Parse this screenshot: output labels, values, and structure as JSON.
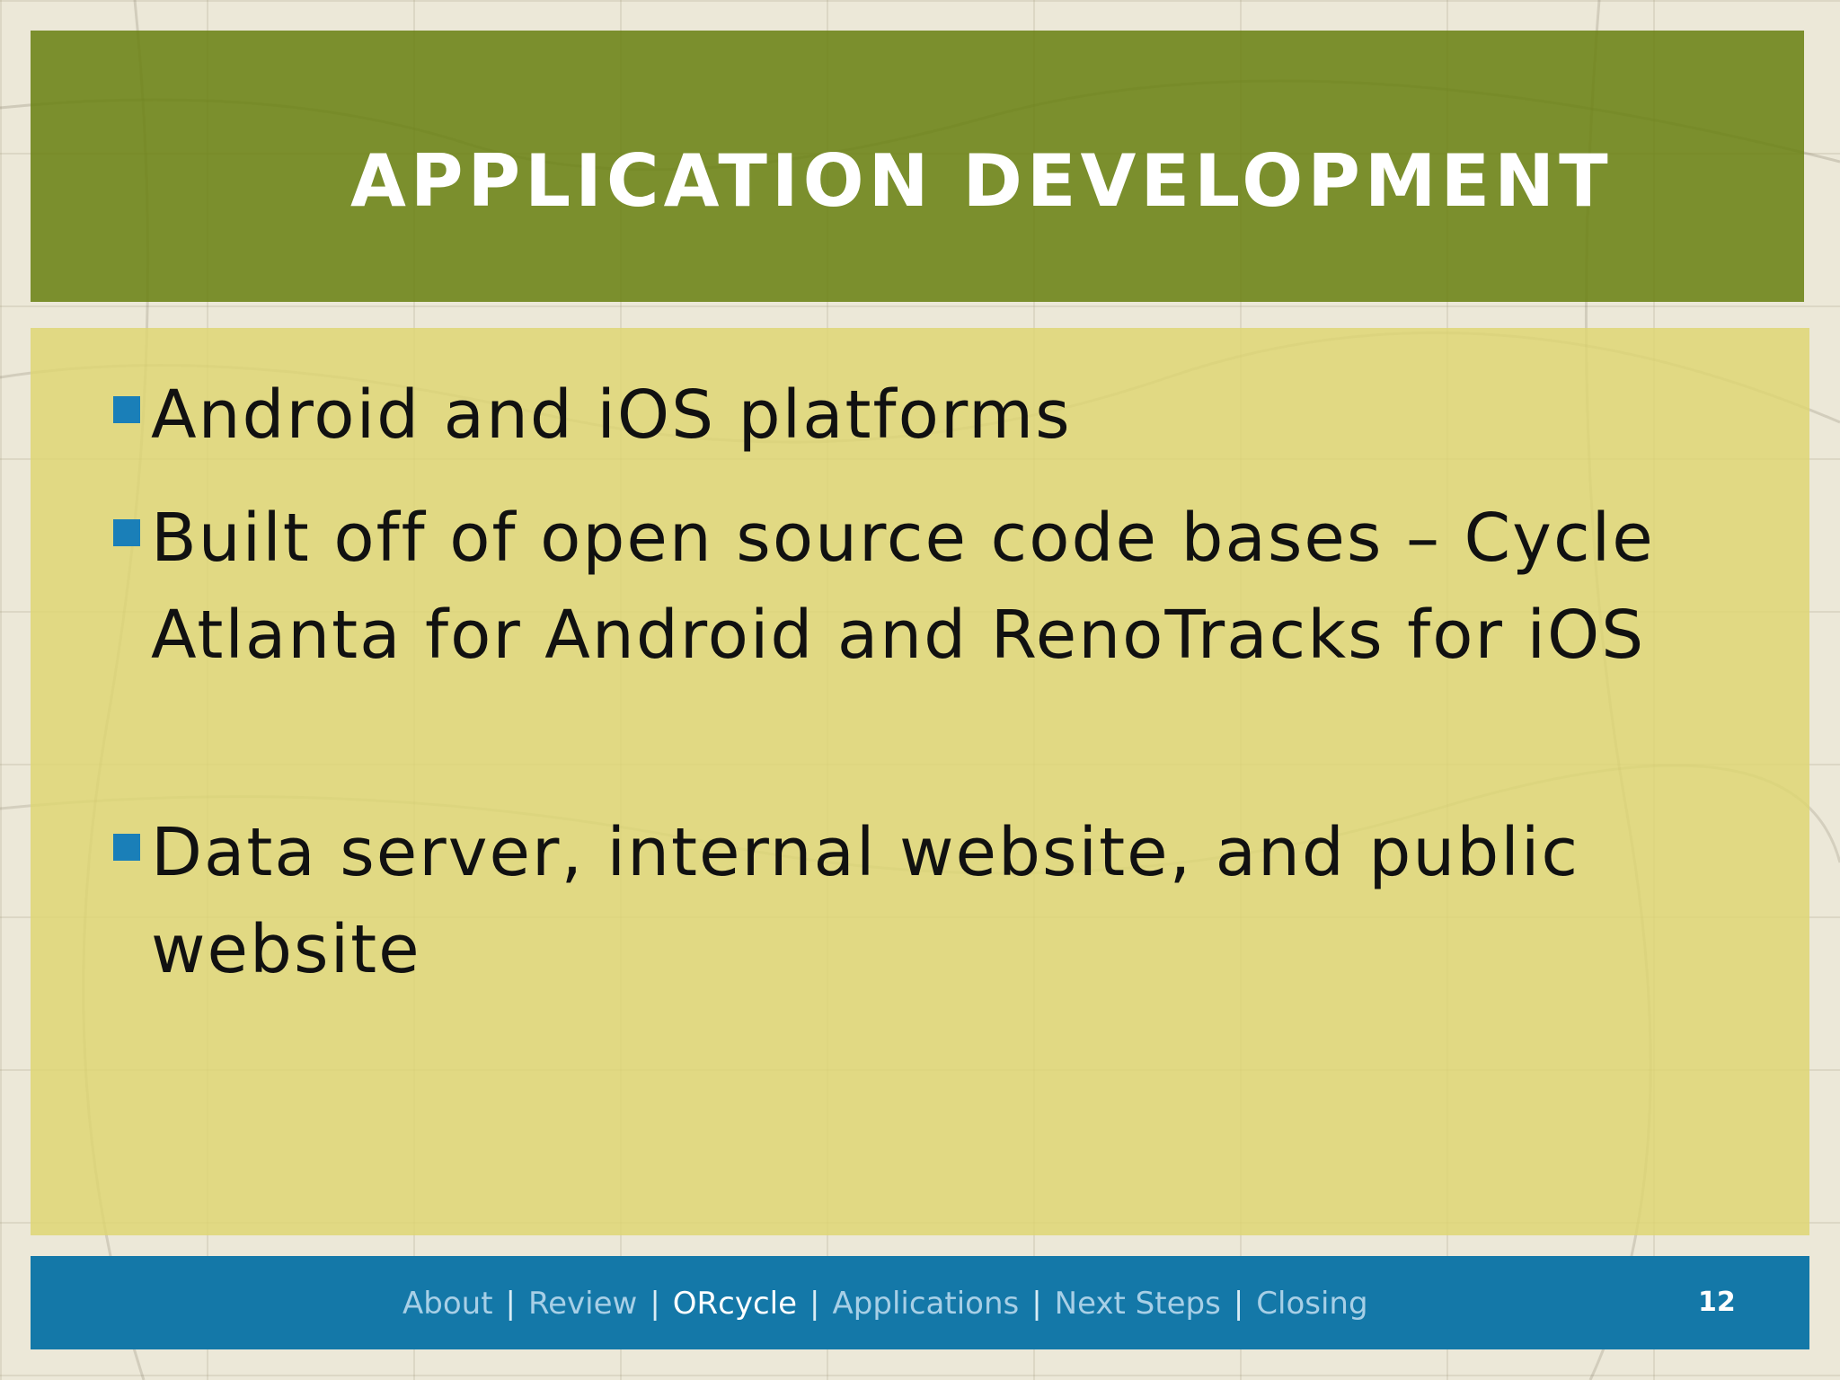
{
  "slide": {
    "title": "APPLICATION DEVELOPMENT",
    "bullets": [
      {
        "text": "Android and iOS platforms"
      },
      {
        "text": "Built off of open source code bases – Cycle Atlanta for Android and RenoTracks for iOS"
      },
      {
        "text": "Data server, internal website, and public website"
      }
    ],
    "page_number": "12"
  },
  "footer_nav": {
    "items": [
      {
        "label": "About",
        "active": false
      },
      {
        "label": "Review",
        "active": false
      },
      {
        "label": "ORcycle",
        "active": true
      },
      {
        "label": "Applications",
        "active": false
      },
      {
        "label": "Next Steps",
        "active": false
      },
      {
        "label": "Closing",
        "active": false
      }
    ],
    "separator": "|"
  },
  "colors": {
    "header_band": "#6b8214",
    "content_band": "#ded670",
    "footer_band": "#1478a8",
    "bullet_marker": "#1a7fb8",
    "nav_active": "#ffffff",
    "nav_inactive": "#a7cfe6"
  }
}
